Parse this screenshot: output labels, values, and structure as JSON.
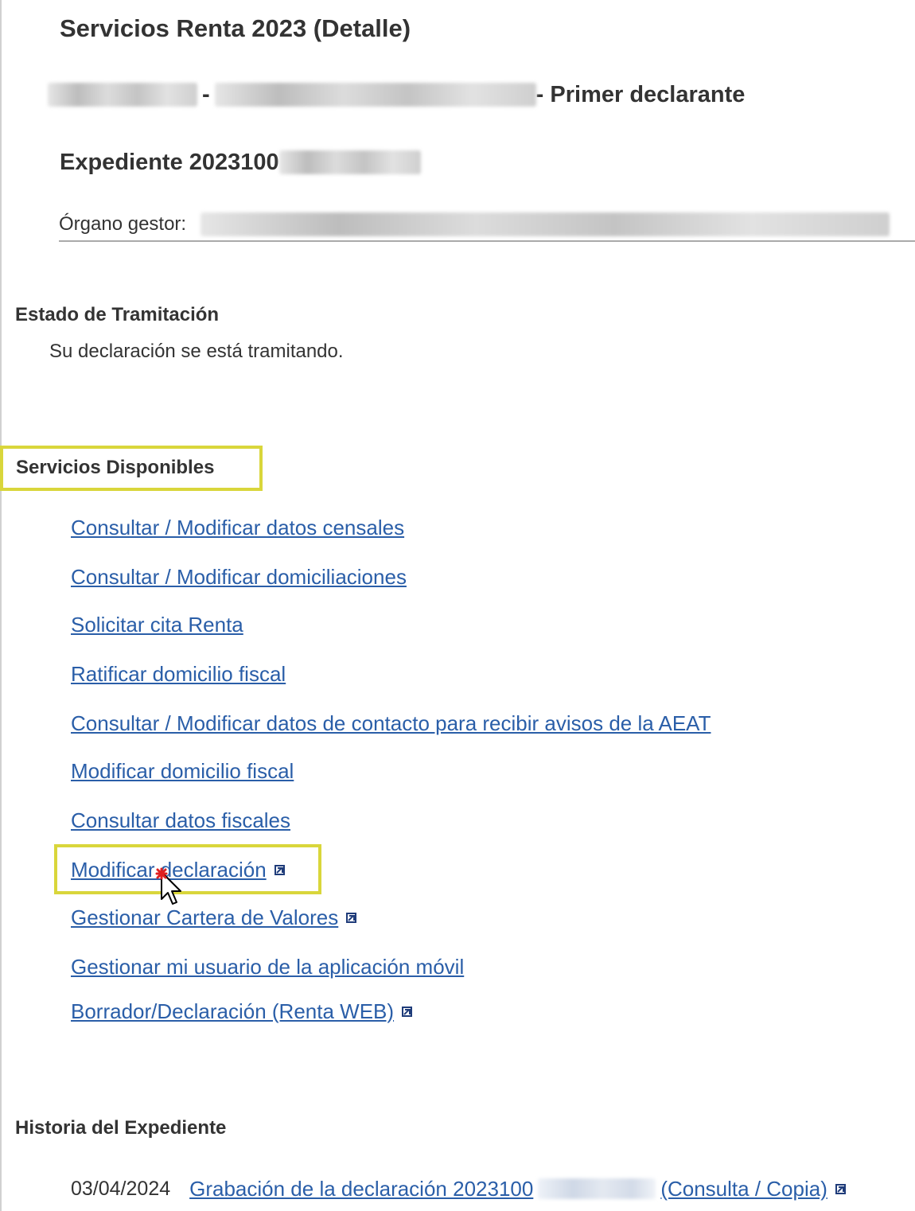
{
  "header": {
    "title": "Servicios Renta 2023 (Detalle)",
    "declarant_separator": "-",
    "declarant_suffix": "- Primer declarante",
    "expediente_label": "Expediente 2023100",
    "organo_label": "Órgano gestor:"
  },
  "estado": {
    "heading": "Estado de Tramitación",
    "text": "Su declaración se está tramitando."
  },
  "servicios": {
    "heading": "Servicios Disponibles",
    "items": [
      {
        "label": "Consultar / Modificar datos censales",
        "external": false
      },
      {
        "label": "Consultar / Modificar domiciliaciones",
        "external": false
      },
      {
        "label": "Solicitar cita Renta",
        "external": false
      },
      {
        "label": "Ratificar domicilio fiscal",
        "external": false
      },
      {
        "label": "Consultar / Modificar datos de contacto para recibir avisos de la AEAT",
        "external": false
      },
      {
        "label": "Modificar domicilio fiscal",
        "external": false
      },
      {
        "label": "Consultar datos fiscales",
        "external": false
      },
      {
        "label": "Modificar declaración",
        "external": true
      },
      {
        "label": "Gestionar Cartera de Valores",
        "external": true
      },
      {
        "label": "Gestionar mi usuario de la aplicación móvil",
        "external": false
      },
      {
        "label": "Borrador/Declaración (Renta WEB)",
        "external": true
      }
    ]
  },
  "historia": {
    "heading": "Historia del Expediente",
    "entries": [
      {
        "date": "03/04/2024",
        "link_prefix": "Grabación de la declaración 2023100",
        "link_suffix": "(Consulta / Copia)"
      }
    ]
  },
  "colors": {
    "link": "#2a5ea8",
    "highlight": "#d9d63b",
    "text": "#333333",
    "cursor_marker": "#e02020"
  },
  "icons": {
    "external_link": "external-link-icon",
    "cursor": "mouse-pointer-icon"
  }
}
